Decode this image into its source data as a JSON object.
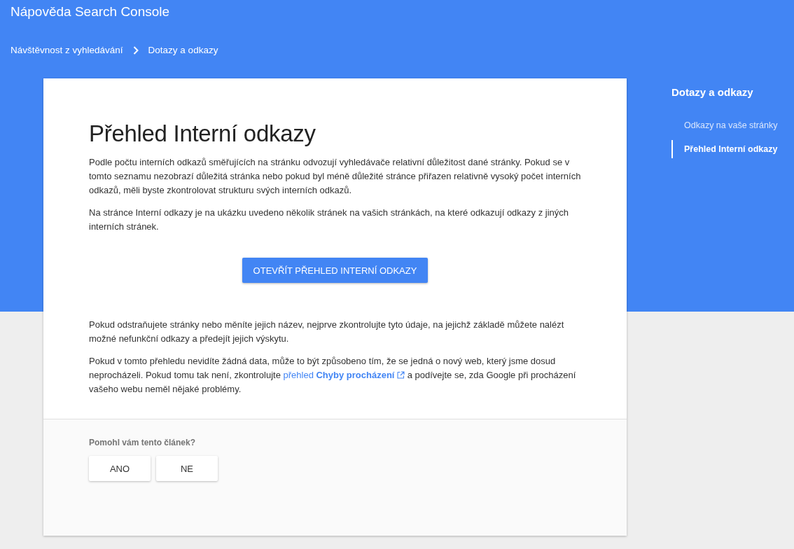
{
  "header": {
    "title": "Nápověda Search Console"
  },
  "breadcrumbs": [
    {
      "label": "Návštěvnost z vyhledávání"
    },
    {
      "label": "Dotazy a odkazy"
    }
  ],
  "article": {
    "title": "Přehled Interní odkazy",
    "intro": [
      "Podle počtu interních odkazů směřujících na stránku odvozují vyhledávače relativní důležitost dané stránky. Pokud se v tomto seznamu nezobrazí důležitá stránka nebo pokud byl méně důležité stránce přiřazen relativně vysoký počet interních odkazů, měli byste zkontrolovat strukturu svých interních odkazů.",
      "Na stránce Interní odkazy je na ukázku uvedeno několik stránek na vašich stránkách, na které odkazují odkazy z jiných interních stránek."
    ],
    "button": "OTEVŘÍT PŘEHLED INTERNÍ ODKAZY",
    "notes": [
      {
        "before": "Pokud odstraňujete stránky nebo měníte jejich název, nejprve zkontrolujte tyto údaje, na jejichž základě můžete nalézt možné nefunkční odkazy a předejít jejich výskytu."
      },
      {
        "before": "Pokud v tomto přehledu nevidíte žádná data, může to být způsobeno tím, že se jedná o nový web, který jsme dosud neprocházeli. Pokud tomu tak není, zkontrolujte ",
        "link": "přehled **Chyby procházení**",
        "after": " a podívejte se, zda Google při procházení vašeho webu neměl nějaké problémy."
      }
    ]
  },
  "feedback": {
    "question": "Pomohl vám tento článek?",
    "buttons": [
      "ANO",
      "NE"
    ]
  },
  "sidebar": {
    "title": "Dotazy a odkazy",
    "items": [
      {
        "label": "Odkazy na vaše stránky",
        "selected": false
      },
      {
        "label": "Přehled Interní odkazy",
        "selected": true
      }
    ]
  }
}
